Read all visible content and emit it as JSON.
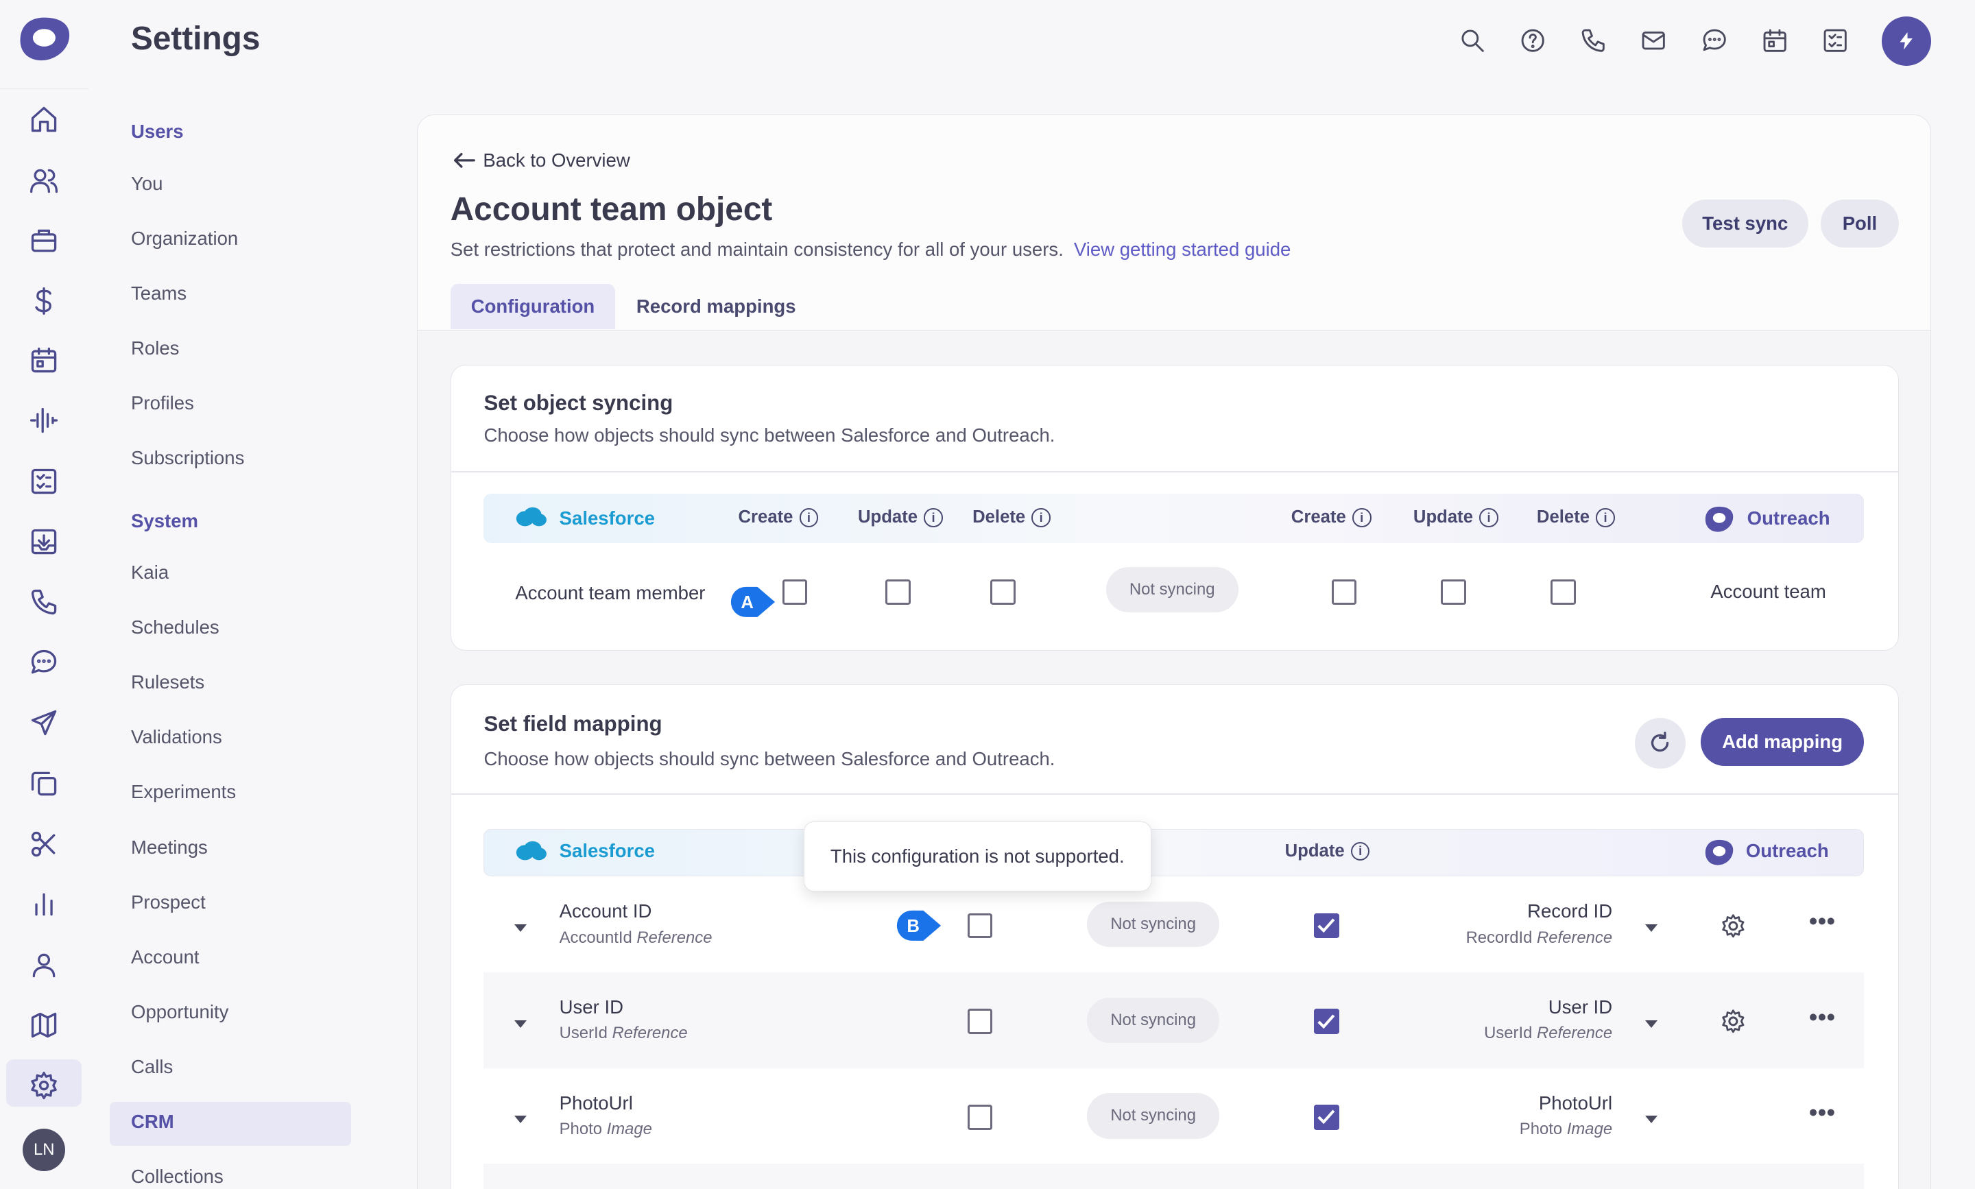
{
  "app": {
    "title": "Settings",
    "user_initials": "LN"
  },
  "submenu": {
    "groups": [
      {
        "heading": "Users",
        "items": [
          "You",
          "Organization",
          "Teams",
          "Roles",
          "Profiles",
          "Subscriptions"
        ]
      },
      {
        "heading": "System",
        "items": [
          "Kaia",
          "Schedules",
          "Rulesets",
          "Validations",
          "Experiments",
          "Meetings",
          "Prospect",
          "Account",
          "Opportunity",
          "Calls",
          "CRM",
          "Collections"
        ]
      }
    ],
    "active": "CRM"
  },
  "rail_icons": [
    "home-icon",
    "people-icon",
    "briefcase-icon",
    "dollar-icon",
    "calendar-icon",
    "activity-icon",
    "tasks-icon",
    "inbox-icon",
    "phone-icon",
    "chat-icon",
    "send-icon",
    "copy-icon",
    "scissors-icon",
    "bar-chart-icon",
    "person-icon",
    "map-icon",
    "settings-icon"
  ],
  "top_icons": [
    "search-icon",
    "help-icon",
    "phone-icon",
    "mail-icon",
    "chat-icon",
    "calendar-icon",
    "checklist-icon"
  ],
  "page": {
    "back_label": "Back to Overview",
    "title": "Account team object",
    "description": "Set restrictions that protect and maintain consistency for all of your users.",
    "guide_link": "View getting started guide",
    "test_sync_label": "Test sync",
    "poll_label": "Poll",
    "tabs": [
      {
        "label": "Configuration",
        "active": true
      },
      {
        "label": "Record mappings",
        "active": false
      }
    ]
  },
  "object_syncing": {
    "title": "Set object syncing",
    "description": "Choose how objects should  sync between Salesforce and Outreach.",
    "left_brand": "Salesforce",
    "right_brand": "Outreach",
    "left_columns": [
      "Create",
      "Update",
      "Delete"
    ],
    "right_columns": [
      "Create",
      "Update",
      "Delete"
    ],
    "row": {
      "left_object": "Account team member",
      "marker": "A",
      "status": "Not syncing",
      "right_object": "Account team",
      "left_checked": [
        false,
        false,
        false
      ],
      "right_checked": [
        false,
        false,
        false
      ]
    }
  },
  "field_mapping": {
    "title": "Set field mapping",
    "description": "Choose how objects should sync between Salesforce and Outreach.",
    "add_label": "Add mapping",
    "left_brand": "Salesforce",
    "right_brand": "Outreach",
    "update_header": "Update",
    "tooltip": "This configuration is not supported.",
    "marker": "B",
    "rows": [
      {
        "left_name": "Account ID",
        "left_api": "AccountId",
        "left_type": "Reference",
        "status": "Not syncing",
        "right_name": "Record ID",
        "right_api": "RecordId",
        "right_type": "Reference",
        "left_checked": false,
        "right_checked": true,
        "gear": true
      },
      {
        "left_name": "User ID",
        "left_api": "UserId",
        "left_type": "Reference",
        "status": "Not syncing",
        "right_name": "User ID",
        "right_api": "UserId",
        "right_type": "Reference",
        "left_checked": false,
        "right_checked": true,
        "gear": true
      },
      {
        "left_name": "PhotoUrl",
        "left_api": "Photo",
        "left_type": "Image",
        "status": "Not syncing",
        "right_name": "PhotoUrl",
        "right_api": "Photo",
        "right_type": "Image",
        "left_checked": false,
        "right_checked": true,
        "gear": false
      }
    ]
  },
  "colors": {
    "accent": "#5451a6",
    "salesforce": "#1a9bd1",
    "link": "#5f5cc6"
  }
}
